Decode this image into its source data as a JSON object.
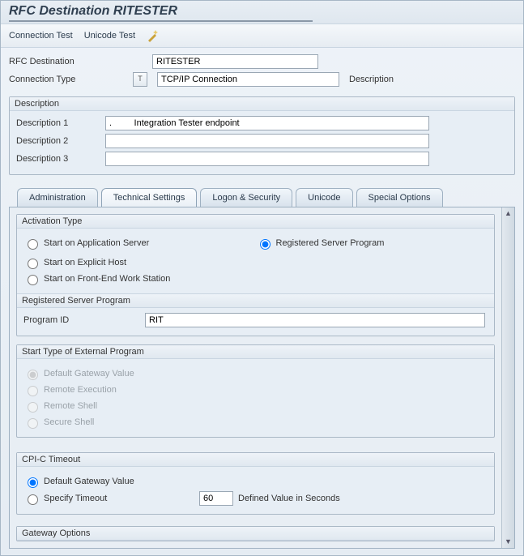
{
  "title": "RFC Destination RITESTER",
  "toolbar": {
    "connection_test": "Connection Test",
    "unicode_test": "Unicode Test"
  },
  "header": {
    "rfc_destination_label": "RFC Destination",
    "rfc_destination_value": "RITESTER",
    "connection_type_label": "Connection Type",
    "connection_type_help": "T",
    "connection_type_value": "TCP/IP Connection",
    "description_label": "Description"
  },
  "description": {
    "legend": "Description",
    "d1_label": "Description 1",
    "d1_value": ".         Integration Tester endpoint",
    "d2_label": "Description 2",
    "d2_value": "",
    "d3_label": "Description 3",
    "d3_value": ""
  },
  "tabs": {
    "administration": "Administration",
    "technical": "Technical Settings",
    "logon": "Logon & Security",
    "unicode": "Unicode",
    "special": "Special Options"
  },
  "activation": {
    "legend": "Activation Type",
    "opt_app_server": "Start on Application Server",
    "opt_registered": "Registered Server Program",
    "opt_explicit": "Start on Explicit Host",
    "opt_frontend": "Start on Front-End Work Station"
  },
  "registered": {
    "legend": "Registered Server Program",
    "program_id_label": "Program ID",
    "program_id_value": "RIT"
  },
  "start_type": {
    "legend": "Start Type of External Program",
    "opt_default": "Default Gateway Value",
    "opt_remote_exec": "Remote Execution",
    "opt_remote_shell": "Remote Shell",
    "opt_secure_shell": "Secure Shell"
  },
  "cpic": {
    "legend": "CPI-C Timeout",
    "opt_default": "Default Gateway Value",
    "opt_specify": "Specify Timeout",
    "timeout_value": "60",
    "defined_label": "Defined Value in Seconds"
  },
  "gateway": {
    "legend": "Gateway Options"
  }
}
